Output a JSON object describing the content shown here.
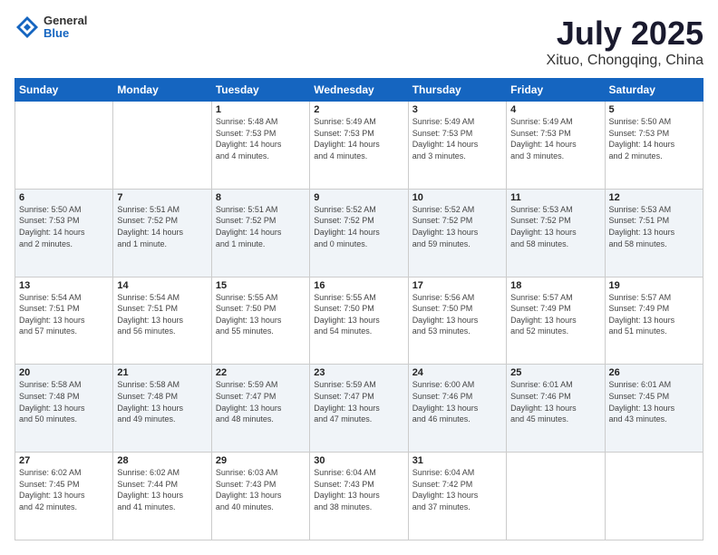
{
  "header": {
    "logo_general": "General",
    "logo_blue": "Blue",
    "title": "July 2025",
    "subtitle": "Xituo, Chongqing, China"
  },
  "weekdays": [
    "Sunday",
    "Monday",
    "Tuesday",
    "Wednesday",
    "Thursday",
    "Friday",
    "Saturday"
  ],
  "weeks": [
    [
      {
        "day": "",
        "info": ""
      },
      {
        "day": "",
        "info": ""
      },
      {
        "day": "1",
        "info": "Sunrise: 5:48 AM\nSunset: 7:53 PM\nDaylight: 14 hours\nand 4 minutes."
      },
      {
        "day": "2",
        "info": "Sunrise: 5:49 AM\nSunset: 7:53 PM\nDaylight: 14 hours\nand 4 minutes."
      },
      {
        "day": "3",
        "info": "Sunrise: 5:49 AM\nSunset: 7:53 PM\nDaylight: 14 hours\nand 3 minutes."
      },
      {
        "day": "4",
        "info": "Sunrise: 5:49 AM\nSunset: 7:53 PM\nDaylight: 14 hours\nand 3 minutes."
      },
      {
        "day": "5",
        "info": "Sunrise: 5:50 AM\nSunset: 7:53 PM\nDaylight: 14 hours\nand 2 minutes."
      }
    ],
    [
      {
        "day": "6",
        "info": "Sunrise: 5:50 AM\nSunset: 7:53 PM\nDaylight: 14 hours\nand 2 minutes."
      },
      {
        "day": "7",
        "info": "Sunrise: 5:51 AM\nSunset: 7:52 PM\nDaylight: 14 hours\nand 1 minute."
      },
      {
        "day": "8",
        "info": "Sunrise: 5:51 AM\nSunset: 7:52 PM\nDaylight: 14 hours\nand 1 minute."
      },
      {
        "day": "9",
        "info": "Sunrise: 5:52 AM\nSunset: 7:52 PM\nDaylight: 14 hours\nand 0 minutes."
      },
      {
        "day": "10",
        "info": "Sunrise: 5:52 AM\nSunset: 7:52 PM\nDaylight: 13 hours\nand 59 minutes."
      },
      {
        "day": "11",
        "info": "Sunrise: 5:53 AM\nSunset: 7:52 PM\nDaylight: 13 hours\nand 58 minutes."
      },
      {
        "day": "12",
        "info": "Sunrise: 5:53 AM\nSunset: 7:51 PM\nDaylight: 13 hours\nand 58 minutes."
      }
    ],
    [
      {
        "day": "13",
        "info": "Sunrise: 5:54 AM\nSunset: 7:51 PM\nDaylight: 13 hours\nand 57 minutes."
      },
      {
        "day": "14",
        "info": "Sunrise: 5:54 AM\nSunset: 7:51 PM\nDaylight: 13 hours\nand 56 minutes."
      },
      {
        "day": "15",
        "info": "Sunrise: 5:55 AM\nSunset: 7:50 PM\nDaylight: 13 hours\nand 55 minutes."
      },
      {
        "day": "16",
        "info": "Sunrise: 5:55 AM\nSunset: 7:50 PM\nDaylight: 13 hours\nand 54 minutes."
      },
      {
        "day": "17",
        "info": "Sunrise: 5:56 AM\nSunset: 7:50 PM\nDaylight: 13 hours\nand 53 minutes."
      },
      {
        "day": "18",
        "info": "Sunrise: 5:57 AM\nSunset: 7:49 PM\nDaylight: 13 hours\nand 52 minutes."
      },
      {
        "day": "19",
        "info": "Sunrise: 5:57 AM\nSunset: 7:49 PM\nDaylight: 13 hours\nand 51 minutes."
      }
    ],
    [
      {
        "day": "20",
        "info": "Sunrise: 5:58 AM\nSunset: 7:48 PM\nDaylight: 13 hours\nand 50 minutes."
      },
      {
        "day": "21",
        "info": "Sunrise: 5:58 AM\nSunset: 7:48 PM\nDaylight: 13 hours\nand 49 minutes."
      },
      {
        "day": "22",
        "info": "Sunrise: 5:59 AM\nSunset: 7:47 PM\nDaylight: 13 hours\nand 48 minutes."
      },
      {
        "day": "23",
        "info": "Sunrise: 5:59 AM\nSunset: 7:47 PM\nDaylight: 13 hours\nand 47 minutes."
      },
      {
        "day": "24",
        "info": "Sunrise: 6:00 AM\nSunset: 7:46 PM\nDaylight: 13 hours\nand 46 minutes."
      },
      {
        "day": "25",
        "info": "Sunrise: 6:01 AM\nSunset: 7:46 PM\nDaylight: 13 hours\nand 45 minutes."
      },
      {
        "day": "26",
        "info": "Sunrise: 6:01 AM\nSunset: 7:45 PM\nDaylight: 13 hours\nand 43 minutes."
      }
    ],
    [
      {
        "day": "27",
        "info": "Sunrise: 6:02 AM\nSunset: 7:45 PM\nDaylight: 13 hours\nand 42 minutes."
      },
      {
        "day": "28",
        "info": "Sunrise: 6:02 AM\nSunset: 7:44 PM\nDaylight: 13 hours\nand 41 minutes."
      },
      {
        "day": "29",
        "info": "Sunrise: 6:03 AM\nSunset: 7:43 PM\nDaylight: 13 hours\nand 40 minutes."
      },
      {
        "day": "30",
        "info": "Sunrise: 6:04 AM\nSunset: 7:43 PM\nDaylight: 13 hours\nand 38 minutes."
      },
      {
        "day": "31",
        "info": "Sunrise: 6:04 AM\nSunset: 7:42 PM\nDaylight: 13 hours\nand 37 minutes."
      },
      {
        "day": "",
        "info": ""
      },
      {
        "day": "",
        "info": ""
      }
    ]
  ]
}
